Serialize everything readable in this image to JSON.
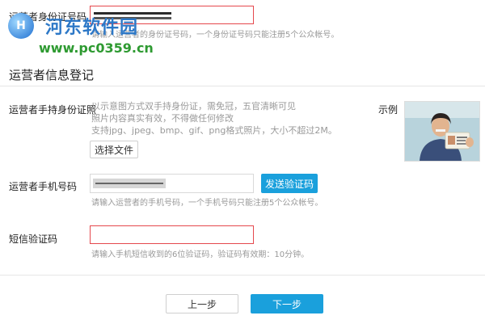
{
  "watermark": {
    "site_name": "河东软件园",
    "url": "www.pc0359.cn",
    "logo_letter": "H"
  },
  "id_number": {
    "label": "运营者身份证号码",
    "hint": "请输入运营者的身份证号码，一个身份证号码只能注册5个公众帐号。"
  },
  "section": {
    "title": "运营者信息登记"
  },
  "id_photo": {
    "label": "运营者手持身份证照",
    "description": [
      "以示意图方式双手持身份证，需免冠，五官清晰可见",
      "照片内容真实有效，不得做任何修改",
      "支持jpg、jpeg、bmp、gif、png格式照片，大小不超过2M。"
    ],
    "choose_file_label": "选择文件",
    "sample_label": "示例"
  },
  "phone": {
    "label": "运营者手机号码",
    "send_code_label": "发送验证码",
    "hint": "请输入运营者的手机号码，一个手机号码只能注册5个公众帐号。"
  },
  "sms": {
    "label": "短信验证码",
    "hint": "请输入手机短信收到的6位验证码，验证码有效期：10分钟。"
  },
  "footer": {
    "prev_label": "上一步",
    "next_label": "下一步"
  }
}
